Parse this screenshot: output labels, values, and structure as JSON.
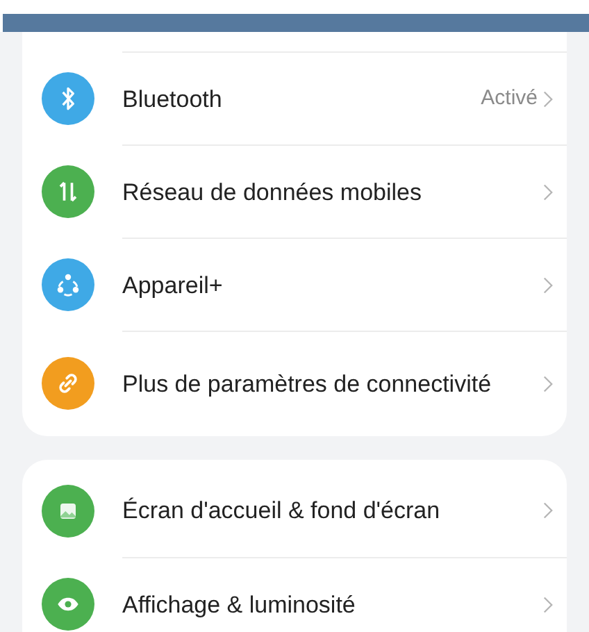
{
  "groups": [
    {
      "items": [
        {
          "label": "Bluetooth",
          "value": "Activé",
          "color": "#3fa9e6"
        },
        {
          "label": "Réseau de données mobiles",
          "color": "#4cb050"
        },
        {
          "label": "Appareil+",
          "color": "#3fa9e6"
        },
        {
          "label": "Plus de paramètres de connectivité",
          "color": "#f29d1f"
        }
      ]
    },
    {
      "items": [
        {
          "label": "Écran d'accueil & fond d'écran",
          "color": "#4cb050"
        },
        {
          "label": "Affichage & luminosité",
          "color": "#4cb050"
        }
      ]
    }
  ]
}
